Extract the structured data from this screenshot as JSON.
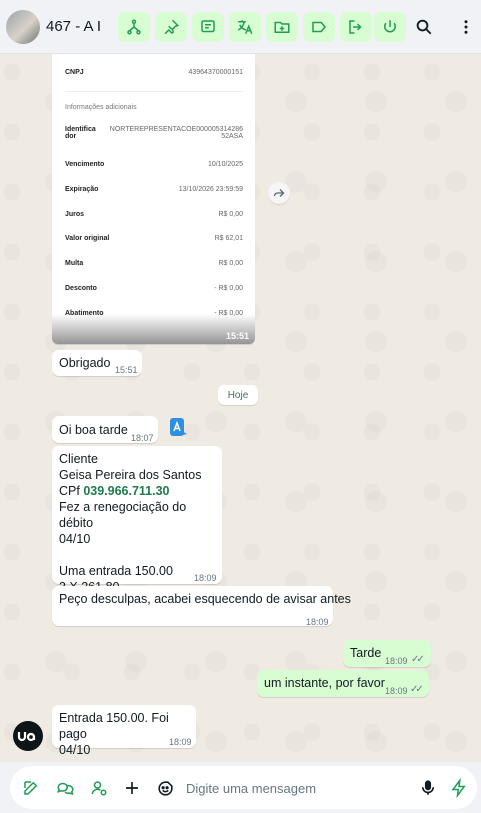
{
  "header": {
    "title": "467 - A I",
    "tools": [
      "flow-icon",
      "pin-icon",
      "note-icon",
      "translate-icon",
      "folder-icon",
      "label-icon",
      "exit-icon",
      "power-icon"
    ],
    "accent": "#d9fdd3",
    "icon_color": "#1f9d55"
  },
  "image_message": {
    "rows": [
      {
        "k": "CNPJ",
        "v": "43964370000151"
      },
      {
        "k": "Informações adicionais",
        "v": ""
      },
      {
        "k": "Identifica dor",
        "v": "NORTEREPRESENTACOE000005314286 52ASA"
      },
      {
        "k": "Vencimento",
        "v": "10/10/2025"
      },
      {
        "k": "Expiração",
        "v": "13/10/2026 23:59:59"
      },
      {
        "k": "Juros",
        "v": "R$ 0,00"
      },
      {
        "k": "Valor original",
        "v": "R$ 62,01"
      },
      {
        "k": "Multa",
        "v": "R$ 0,00"
      },
      {
        "k": "Desconto",
        "v": "- R$ 0,00"
      },
      {
        "k": "Abatimento",
        "v": "- R$ 0,00"
      }
    ],
    "time": "15:51"
  },
  "messages": {
    "m1": {
      "text": "Obrigado",
      "time": "15:51"
    },
    "date_chip": "Hoje",
    "m2": {
      "text": "Oi boa tarde",
      "time": "18:07"
    },
    "m3": {
      "line1": "Cliente",
      "line2": "Geisa Pereira dos Santos",
      "cpf_label": "CPf ",
      "cpf": "039.966.711.30",
      "line4": "Fez a renegociação do débito",
      "line5": "04/10",
      "line6": "Uma entrada 150.00",
      "line7": "3 X 261.80",
      "time": "18:09"
    },
    "m4": {
      "text": "Peço desculpas, acabei esquecendo de avisar antes",
      "time": "18:09"
    },
    "m5": {
      "text": "Tarde",
      "time": "18:09"
    },
    "m6": {
      "text": "um instante, por favor",
      "time": "18:09"
    },
    "m7": {
      "line1": "Entrada 150.00. Foi pago",
      "line2": "04/10",
      "time": "18:09"
    }
  },
  "composer": {
    "placeholder": "Digite uma mensagem"
  }
}
